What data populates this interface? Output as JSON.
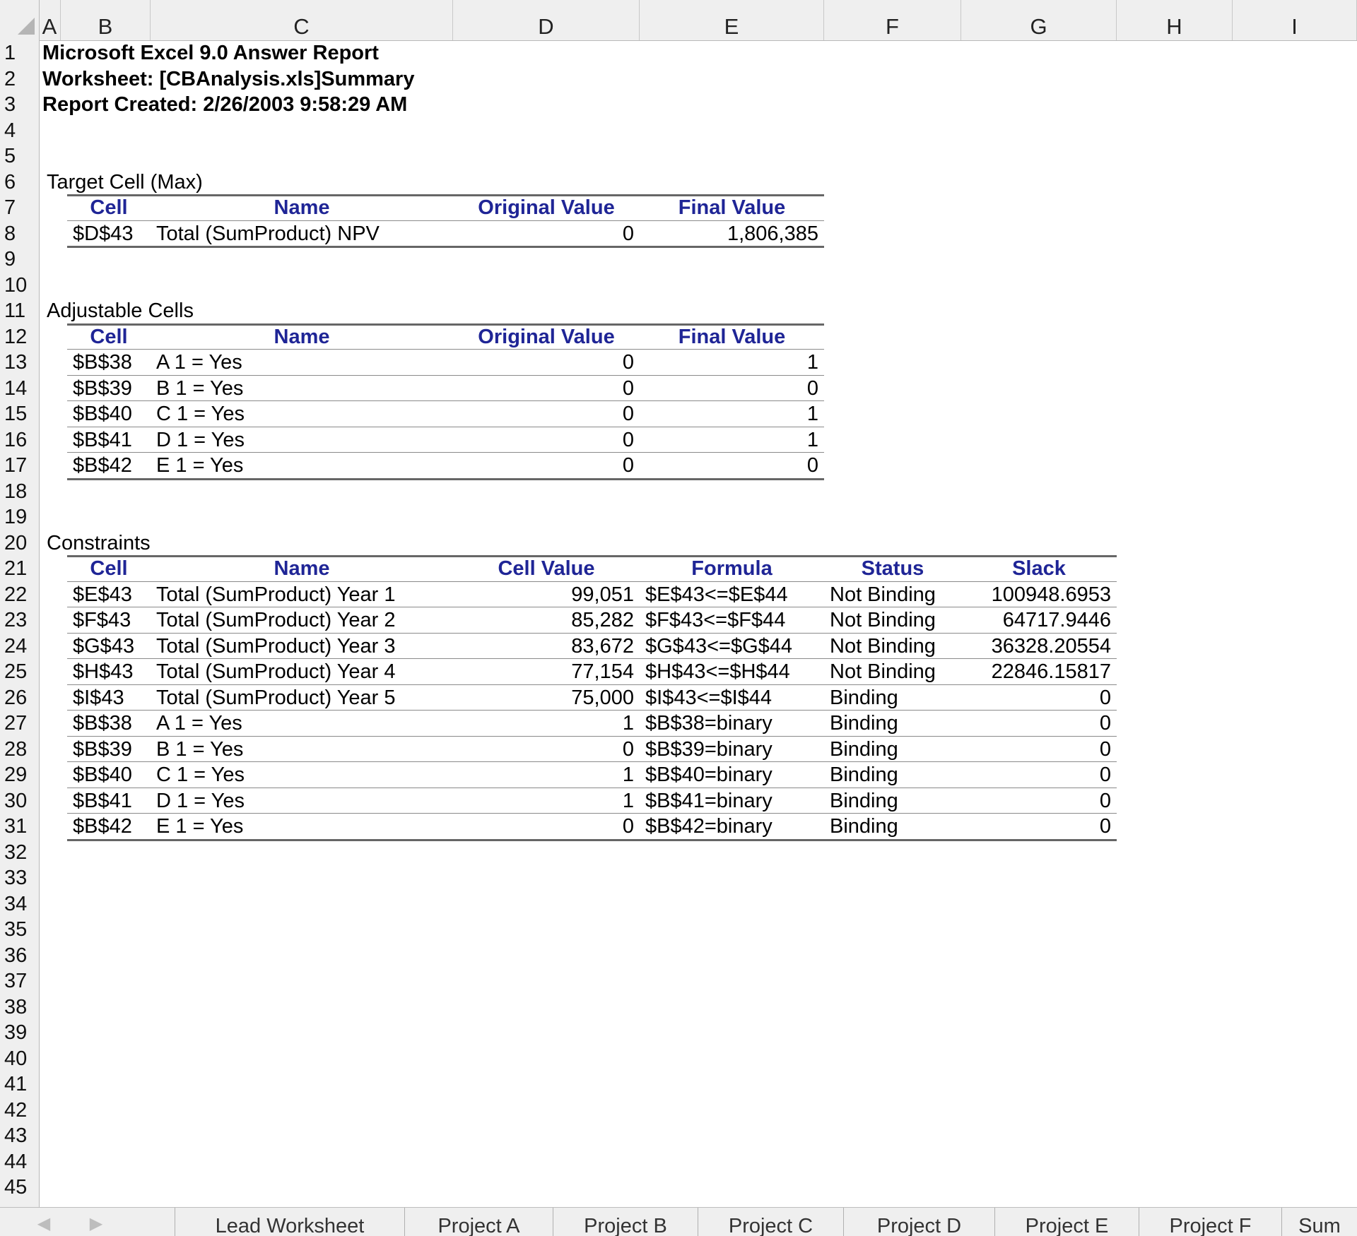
{
  "columns": [
    "A",
    "B",
    "C",
    "D",
    "E",
    "F",
    "G",
    "H",
    "I"
  ],
  "rows": [
    "1",
    "2",
    "3",
    "4",
    "5",
    "6",
    "7",
    "8",
    "9",
    "10",
    "11",
    "12",
    "13",
    "14",
    "15",
    "16",
    "17",
    "18",
    "19",
    "20",
    "21",
    "22",
    "23",
    "24",
    "25",
    "26",
    "27",
    "28",
    "29",
    "30",
    "31",
    "32",
    "33",
    "34",
    "35",
    "36",
    "37",
    "38",
    "39",
    "40",
    "41",
    "42",
    "43",
    "44",
    "45"
  ],
  "report": {
    "title": "Microsoft Excel 9.0 Answer Report",
    "worksheet": "Worksheet: [CBAnalysis.xls]Summary",
    "created": "Report Created: 2/26/2003 9:58:29 AM"
  },
  "target": {
    "section_label": "Target Cell (Max)",
    "headers": [
      "Cell",
      "Name",
      "Original Value",
      "Final Value"
    ],
    "rows": [
      [
        "$D$43",
        "Total (SumProduct) NPV",
        "0",
        "1,806,385"
      ]
    ]
  },
  "adjustable": {
    "section_label": "Adjustable Cells",
    "headers": [
      "Cell",
      "Name",
      "Original Value",
      "Final Value"
    ],
    "rows": [
      [
        "$B$38",
        "A 1 = Yes",
        "0",
        "1"
      ],
      [
        "$B$39",
        "B 1 = Yes",
        "0",
        "0"
      ],
      [
        "$B$40",
        "C 1 = Yes",
        "0",
        "1"
      ],
      [
        "$B$41",
        "D 1 = Yes",
        "0",
        "1"
      ],
      [
        "$B$42",
        "E 1 = Yes",
        "0",
        "0"
      ]
    ]
  },
  "constraints": {
    "section_label": "Constraints",
    "headers": [
      "Cell",
      "Name",
      "Cell Value",
      "Formula",
      "Status",
      "Slack"
    ],
    "rows": [
      [
        "$E$43",
        "Total (SumProduct) Year 1",
        "99,051",
        "$E$43<=$E$44",
        "Not Binding",
        "100948.6953"
      ],
      [
        "$F$43",
        "Total (SumProduct) Year 2",
        "85,282",
        "$F$43<=$F$44",
        "Not Binding",
        "64717.9446"
      ],
      [
        "$G$43",
        "Total (SumProduct) Year 3",
        "83,672",
        "$G$43<=$G$44",
        "Not Binding",
        "36328.20554"
      ],
      [
        "$H$43",
        "Total (SumProduct) Year 4",
        "77,154",
        "$H$43<=$H$44",
        "Not Binding",
        "22846.15817"
      ],
      [
        "$I$43",
        "Total (SumProduct) Year 5",
        "75,000",
        "$I$43<=$I$44",
        "Binding",
        "0"
      ],
      [
        "$B$38",
        "A 1 = Yes",
        "1",
        "$B$38=binary",
        "Binding",
        "0"
      ],
      [
        "$B$39",
        "B 1 = Yes",
        "0",
        "$B$39=binary",
        "Binding",
        "0"
      ],
      [
        "$B$40",
        "C 1 = Yes",
        "1",
        "$B$40=binary",
        "Binding",
        "0"
      ],
      [
        "$B$41",
        "D 1 = Yes",
        "1",
        "$B$41=binary",
        "Binding",
        "0"
      ],
      [
        "$B$42",
        "E 1 = Yes",
        "0",
        "$B$42=binary",
        "Binding",
        "0"
      ]
    ]
  },
  "tabs": [
    "Lead Worksheet",
    "Project A",
    "Project B",
    "Project C",
    "Project D",
    "Project E",
    "Project F",
    "Sum"
  ],
  "colors": {
    "header_text": "#1f2596",
    "chrome": "#efefef",
    "rule": "#666666"
  }
}
